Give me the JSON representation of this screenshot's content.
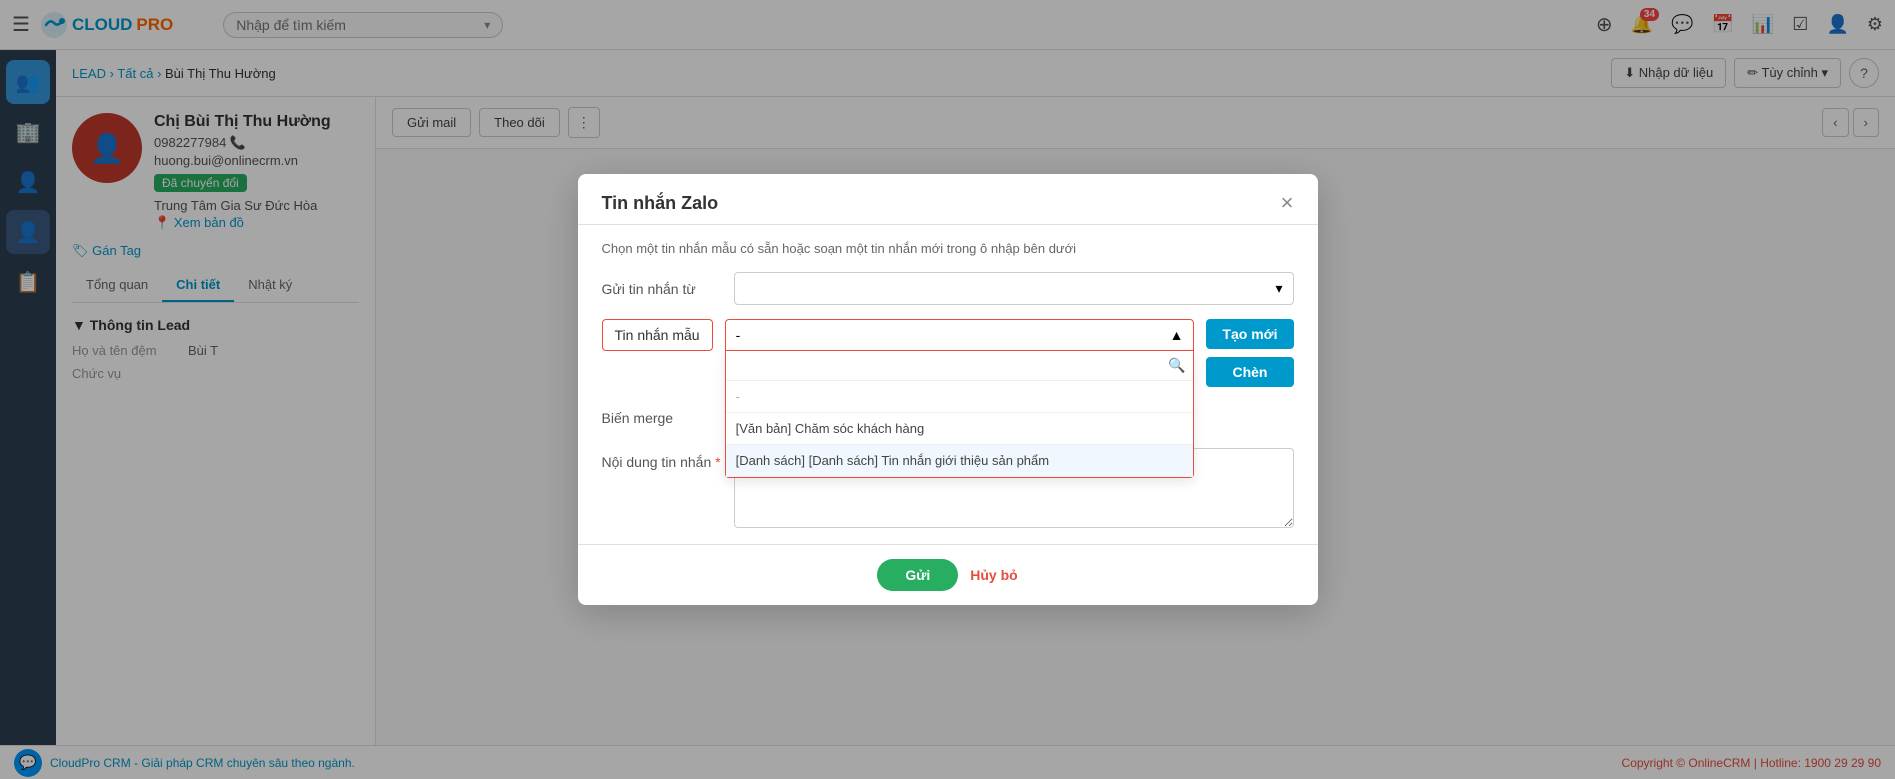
{
  "topNav": {
    "logoCloud": "CLOUD",
    "logoPro": "PRO",
    "searchPlaceholder": "Nhập để tìm kiếm",
    "notificationCount": "34"
  },
  "breadcrumb": {
    "lead": "LEAD",
    "separator1": "›",
    "tatCa": "Tất cả",
    "separator2": "›",
    "contactName": "Bùi Thị Thu Hường"
  },
  "actionBar": {
    "importLabel": "Nhập dữ liệu",
    "customLabel": "Tùy chỉnh"
  },
  "contact": {
    "prefix": "Chị Bùi Thị Thu Hường",
    "phone": "0982277984",
    "email": "huong.bui@onlinecrm.vn",
    "statusBadge": "Đã chuyển đổi",
    "address": "Trung Tâm Gia Sư Đức Hòa",
    "mapLink": "Xem bản đồ",
    "tagLabel": "Gán Tag"
  },
  "tabs": {
    "tongQuan": "Tổng quan",
    "chiTiet": "Chi tiết",
    "nhatKy": "Nhật ký"
  },
  "infoSection": {
    "title": "Thông tin Lead",
    "fields": [
      {
        "label": "Họ và tên đệm",
        "value": "Bùi T"
      },
      {
        "label": "Chức vụ",
        "value": ""
      }
    ]
  },
  "rightActions": {
    "sendMailLabel": "Gửi mail",
    "followLabel": "Theo dõi",
    "dotsLabel": "⋮"
  },
  "modal": {
    "title": "Tin nhắn Zalo",
    "closeIcon": "×",
    "subtitle": "Chọn một tin nhắn mẫu có sẵn hoặc soạn một tin nhắn mới trong ô nhập bên dưới",
    "sendFromLabel": "Gửi tin nhắn từ",
    "sendFromPlaceholder": "",
    "templateLabel": "Tin nhắn mẫu",
    "templateSelectedValue": "-",
    "mergeLabel": "Biến merge",
    "contentLabel": "Nội dung tin nhắn",
    "contentRequired": "*",
    "createNewLabel": "Tạo mới",
    "insertLabel": "Chèn",
    "dropdownSearch": "",
    "dropdownItems": [
      {
        "id": "dash",
        "label": "-",
        "type": "separator"
      },
      {
        "id": "item1",
        "label": "[Văn bản] Chăm sóc khách hàng",
        "type": "normal"
      },
      {
        "id": "item2",
        "label": "[Danh sách] [Danh sách] Tin nhắn giới thiệu sản phẩm",
        "type": "selected"
      }
    ],
    "sendLabel": "Gửi",
    "cancelLabel": "Hủy bỏ"
  },
  "footer": {
    "leftText": "CloudPro CRM - Giải pháp CRM chuyên sâu theo ngành.",
    "rightText": "Copyright © OnlineCRM | Hotline: ",
    "hotline": "1900 29 29 90"
  },
  "sidebar": {
    "items": [
      {
        "icon": "☰",
        "name": "menu"
      },
      {
        "icon": "👥",
        "name": "users"
      },
      {
        "icon": "🏢",
        "name": "building"
      },
      {
        "icon": "👤",
        "name": "user"
      },
      {
        "icon": "📋",
        "name": "list"
      }
    ]
  }
}
